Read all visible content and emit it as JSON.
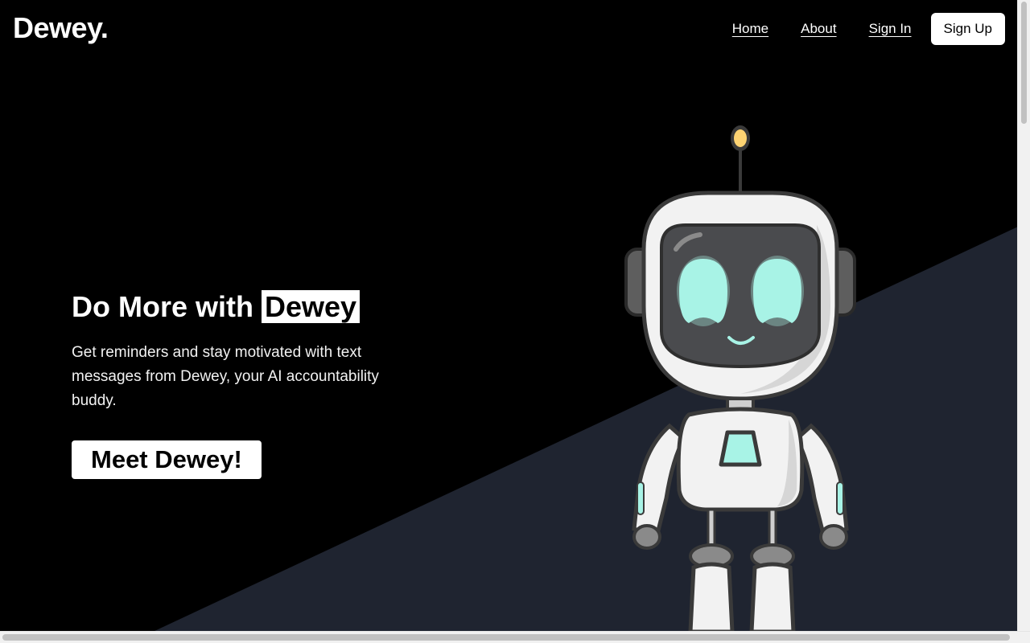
{
  "brand": {
    "name": "Dewey."
  },
  "nav": {
    "home": "Home",
    "about": "About",
    "sign_in": "Sign In",
    "sign_up": "Sign Up"
  },
  "hero": {
    "title_prefix": "Do More with",
    "title_highlight": "Dewey",
    "description": "Get reminders and stay motivated with text messages from Dewey, your AI accountability buddy.",
    "cta": "Meet Dewey!"
  },
  "illustration": {
    "icon": "robot-mascot"
  },
  "colors": {
    "background": "#000000",
    "diagonal_panel": "#1f2430",
    "accent_eyes": "#a8f3e6",
    "antenna_light": "#fdd372",
    "button_bg": "#ffffff",
    "button_text": "#000000"
  }
}
